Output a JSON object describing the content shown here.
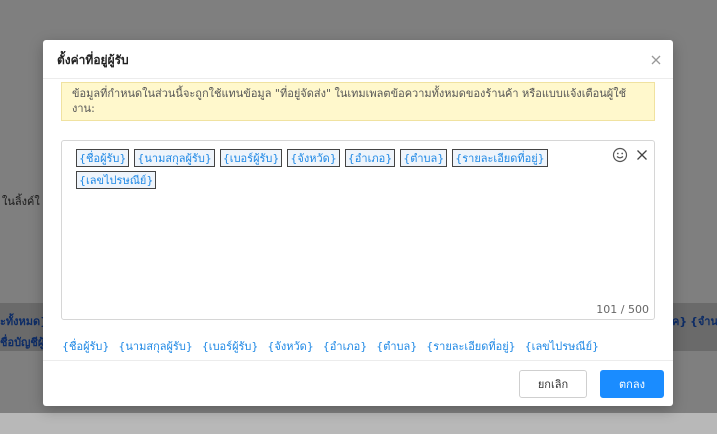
{
  "background": {
    "fragment_left": "ในลิ้งค์ใ",
    "strip_left_1": "ะทั้งหมด}",
    "strip_left_2": "ชื่อบัญชีผู้",
    "strip_right_1": "ค}",
    "strip_right_2": "{จำน"
  },
  "dialog": {
    "title": "ตั้งค่าที่อยู่ผู้รับ",
    "notice": "ข้อมูลที่กำหนดในส่วนนี้จะถูกใช้แทนข้อมูล \"ที่อยู่จัดส่ง\" ในเทมเพลตข้อความทั้งหมดของร้านค้า หรือแบบแจ้งเตือนผู้ใช้งาน:",
    "editor": {
      "tags": [
        "{ชื่อผู้รับ}",
        "{นามสกุลผู้รับ}",
        "{เบอร์ผู้รับ}",
        "{จังหวัด}",
        "{อำเภอ}",
        "{ตำบล}",
        "{รายละเอียดที่อยู่}",
        "{เลขไปรษณีย์}"
      ],
      "counter": "101 / 500",
      "icons": [
        "smiley-icon",
        "clear-icon"
      ]
    },
    "variables": [
      "{ชื่อผู้รับ}",
      "{นามสกุลผู้รับ}",
      "{เบอร์ผู้รับ}",
      "{จังหวัด}",
      "{อำเภอ}",
      "{ตำบล}",
      "{รายละเอียดที่อยู่}",
      "{เลขไปรษณีย์}"
    ],
    "buttons": {
      "cancel": "ยกเลิก",
      "ok": "ตกลง"
    }
  },
  "colors": {
    "accent": "#1a8cff",
    "tag_text": "#1e88e5",
    "notice_bg": "#fff8cc"
  }
}
